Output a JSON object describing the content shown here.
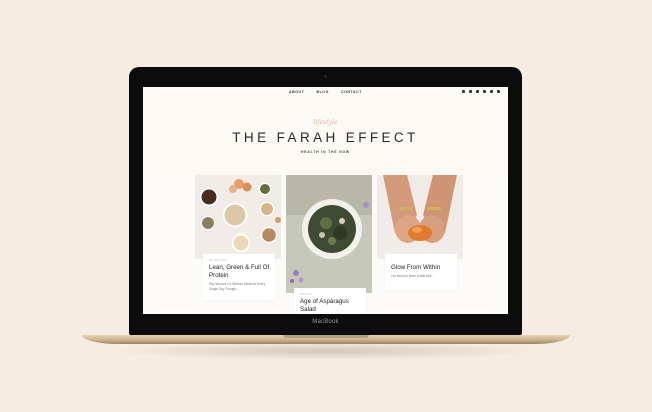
{
  "device": {
    "label": "MacBook"
  },
  "nav": {
    "links": [
      "ABOUT",
      "BLOG",
      "CONTACT"
    ]
  },
  "hero": {
    "script_text": "lifestyle",
    "brand": "THE FARAH EFFECT",
    "tagline": "HEALTH IN THE NOW"
  },
  "posts": [
    {
      "category": "NUTRITION",
      "title": "Lean, Green & Full Of Protein",
      "excerpt": "Say Woooo! I'm Without Meals At Every Single Day Though..."
    },
    {
      "category": "RECIPE",
      "title": "Age of Asparagus Salad"
    },
    {
      "category": "",
      "title": "Glow From Within",
      "excerpt": "I've found is there a little hint..."
    }
  ],
  "colors": {
    "background": "#f5ede2",
    "accent": "#e3b79e",
    "text": "#2a2a2a"
  }
}
